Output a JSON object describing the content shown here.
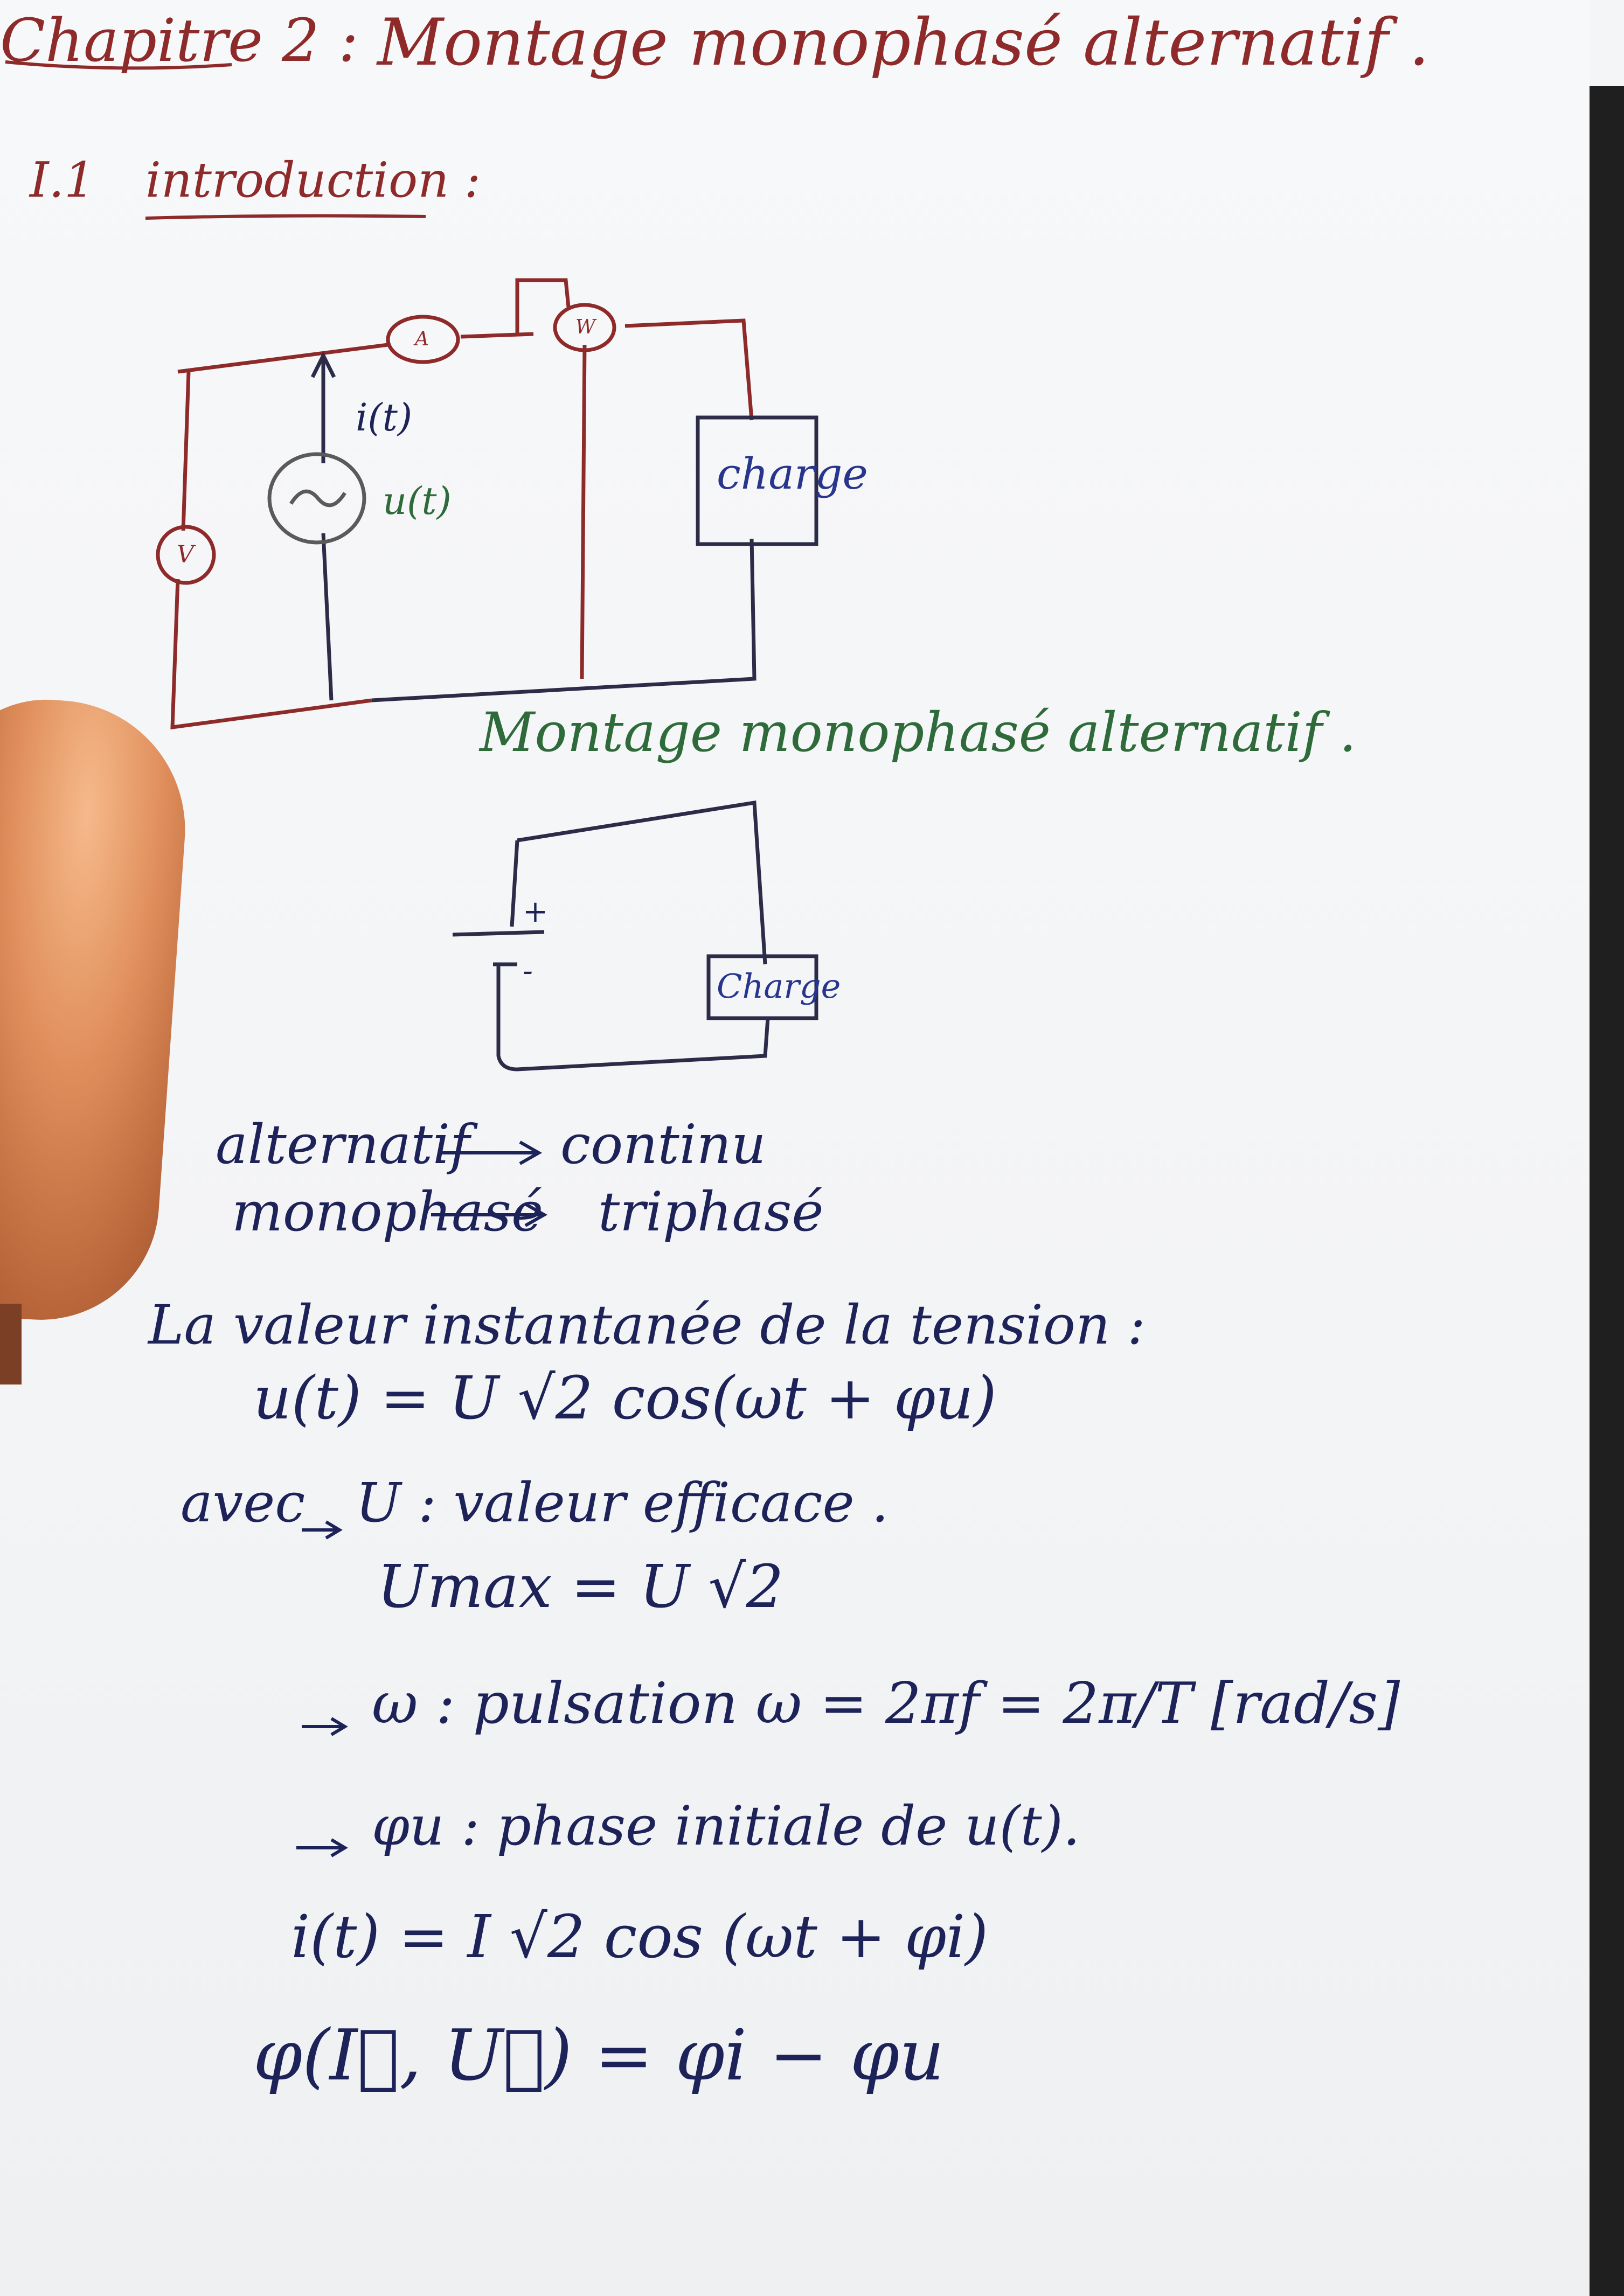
{
  "chapter_title": {
    "label": "Chapitre 2 :",
    "text": "Montage monophasé alternatif ."
  },
  "section": {
    "number": "I.1",
    "title": "introduction :"
  },
  "diagram1": {
    "ammeter": "A",
    "wattmeter": "W",
    "voltmeter": "V",
    "current_label": "i(t)",
    "source_label": "u(t)",
    "load_label": "charge",
    "caption": "Montage monophasé alternatif ."
  },
  "diagram2": {
    "plus": "+",
    "minus": "-",
    "load_label": "Charge"
  },
  "correspondence": [
    {
      "from": "alternatif",
      "to": "continu"
    },
    {
      "from": "monophasé",
      "to": "triphasé"
    }
  ],
  "notes": {
    "heading": "La valeur instantanée de la tension :",
    "eq_u": "u(t) = U √2 cos(ωt + φu)",
    "avec": "avec",
    "u_def": "U : valeur efficace .",
    "umax": "Umax = U √2",
    "omega_def": "ω : pulsation  ω = 2πf = 2π/T  [rad/s]",
    "phi_def": "φu : phase initiale de u(t).",
    "eq_i": "i(t) = I √2 cos (ωt + φi)",
    "eq_phi": "φ(I⃗, U⃗) = φi − φu"
  },
  "colors": {
    "red_ink": "#8e2a2a",
    "blue_ink": "#27358c",
    "green_ink": "#2f6b3a",
    "paper": "#f4f5f6"
  }
}
